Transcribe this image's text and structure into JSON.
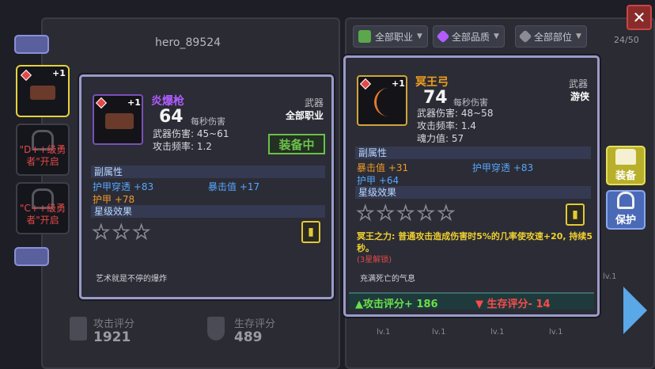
{
  "header": {
    "hero_name": "hero_89524",
    "filters": [
      {
        "label": "全部职业",
        "color": "#5aa84a"
      },
      {
        "label": "全部品质",
        "color": "#b05cff"
      },
      {
        "label": "全部部位",
        "color": "#8a8b95"
      }
    ],
    "inventory_count": "24/50",
    "close_glyph": "✕"
  },
  "sidebar": {
    "slots": [
      {
        "plus": "+1",
        "selected": true
      },
      {
        "lock_text": "\"D++级勇者\"开启"
      },
      {
        "lock_text": "\"C++级勇者\"开启"
      }
    ]
  },
  "hero_stats": {
    "attack_label": "攻击评分",
    "attack_value": "1921",
    "survival_label": "生存评分",
    "survival_value": "489"
  },
  "equipped_card": {
    "plus": "+1",
    "name": "炎爆枪",
    "dps": "64",
    "dps_label": "每秒伤害",
    "stats": [
      "武器伤害: 45~61",
      "攻击频率: 1.2"
    ],
    "type_label": "武器",
    "class_label": "全部职业",
    "equipped_label": "装备中",
    "sub_attr_header": "副属性",
    "sub_attrs": [
      {
        "text": "护甲穿透 +83",
        "color": "blue"
      },
      {
        "text": "暴击值 +17",
        "color": "blue"
      },
      {
        "text": "护甲 +78",
        "color": "orange"
      }
    ],
    "star_header": "星级效果",
    "stars": 3,
    "flavor": "艺术就是不停的爆炸"
  },
  "compare_card": {
    "plus": "+1",
    "name": "冥王弓",
    "dps": "74",
    "dps_label": "每秒伤害",
    "stats": [
      "武器伤害: 48~58",
      "攻击频率: 1.4",
      "魂力值: 57"
    ],
    "type_label": "武器",
    "class_label": "游侠",
    "sub_attr_header": "副属性",
    "sub_attrs": [
      {
        "text": "暴击值 +31",
        "color": "orange"
      },
      {
        "text": "护甲穿透 +83",
        "color": "blue"
      },
      {
        "text": "护甲 +64",
        "color": "blue"
      }
    ],
    "star_header": "星级效果",
    "stars": 5,
    "skill_line1": "冥王之力: 普通攻击造成伤害时5%的几率使攻速+20, 持续5",
    "skill_line2": "秒。",
    "skill_unlock": "(3星解锁)",
    "flavor": "充满死亡的气息",
    "attack_delta": "▲攻击评分+ 186",
    "survival_delta": "▼ 生存评分- 14"
  },
  "side_buttons": {
    "equip_label": "装备",
    "protect_label": "保护"
  },
  "grid_levels": [
    "lv.1",
    "lv.1",
    "lv.1",
    "lv.1",
    "lv.1"
  ],
  "colors": {
    "accent_purple": "#b05cff",
    "accent_gold": "#f0a020",
    "equipped_green": "#6bc14a"
  }
}
